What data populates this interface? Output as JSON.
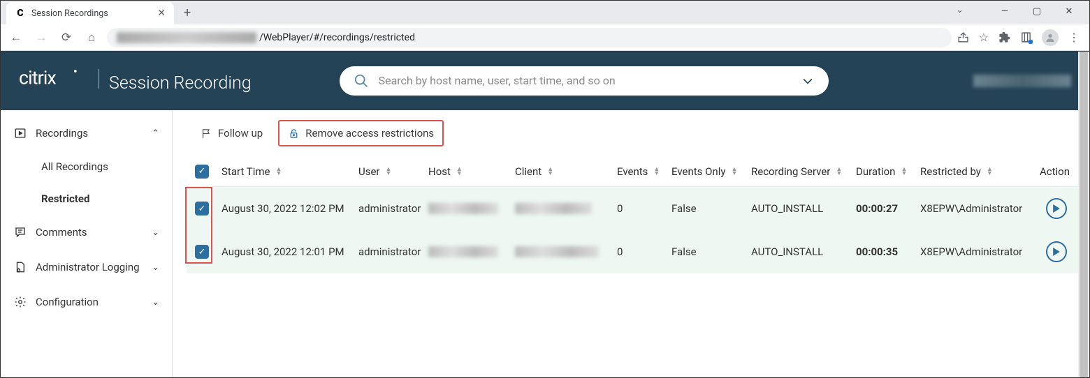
{
  "browser": {
    "tab_title": "Session Recordings",
    "url_visible": "/WebPlayer/#/recordings/restricted"
  },
  "header": {
    "brand": "citrix",
    "product": "Session Recording",
    "search_placeholder": "Search by host name, user, start time, and so on"
  },
  "sidebar": {
    "recordings": "Recordings",
    "all_recordings": "All Recordings",
    "restricted": "Restricted",
    "comments": "Comments",
    "admin_logging": "Administrator Logging",
    "configuration": "Configuration"
  },
  "actions": {
    "follow_up": "Follow up",
    "remove_restrictions": "Remove access restrictions"
  },
  "table": {
    "headers": {
      "start_time": "Start Time",
      "user": "User",
      "host": "Host",
      "client": "Client",
      "events": "Events",
      "events_only": "Events Only",
      "recording_server": "Recording Server",
      "duration": "Duration",
      "restricted_by": "Restricted by",
      "action": "Action"
    },
    "rows": [
      {
        "start_time": "August 30, 2022 12:02 PM",
        "user": "administrator",
        "events": "0",
        "events_only": "False",
        "recording_server": "AUTO_INSTALL",
        "duration": "00:00:27",
        "restricted_by": "X8EPW\\Administrator"
      },
      {
        "start_time": "August 30, 2022 12:01 PM",
        "user": "administrator",
        "events": "0",
        "events_only": "False",
        "recording_server": "AUTO_INSTALL",
        "duration": "00:00:35",
        "restricted_by": "X8EPW\\Administrator"
      }
    ]
  }
}
